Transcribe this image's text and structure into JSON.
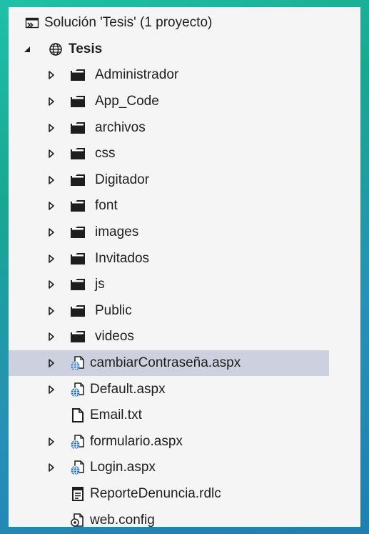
{
  "solution": {
    "label": "Solución 'Tesis'  (1 proyecto)",
    "icon": "solution-icon"
  },
  "project": {
    "label": "Tesis",
    "icon": "globe-web-project-icon",
    "expanded": true
  },
  "items": [
    {
      "label": "Administrador",
      "type": "folder",
      "expander": true
    },
    {
      "label": "App_Code",
      "type": "folder",
      "expander": true
    },
    {
      "label": "archivos",
      "type": "folder",
      "expander": true
    },
    {
      "label": "css",
      "type": "folder",
      "expander": true
    },
    {
      "label": "Digitador",
      "type": "folder",
      "expander": true
    },
    {
      "label": "font",
      "type": "folder",
      "expander": true
    },
    {
      "label": "images",
      "type": "folder",
      "expander": true
    },
    {
      "label": "Invitados",
      "type": "folder",
      "expander": true
    },
    {
      "label": "js",
      "type": "folder",
      "expander": true
    },
    {
      "label": "Public",
      "type": "folder",
      "expander": true
    },
    {
      "label": "videos",
      "type": "folder",
      "expander": true
    },
    {
      "label": "cambiarContraseña.aspx",
      "type": "aspx",
      "expander": true,
      "selected": true
    },
    {
      "label": "Default.aspx",
      "type": "aspx",
      "expander": true
    },
    {
      "label": "Email.txt",
      "type": "txt",
      "expander": false
    },
    {
      "label": "formulario.aspx",
      "type": "aspx",
      "expander": true
    },
    {
      "label": "Login.aspx",
      "type": "aspx",
      "expander": true
    },
    {
      "label": "ReporteDenuncia.rdlc",
      "type": "rdlc",
      "expander": false
    },
    {
      "label": "web.config",
      "type": "config",
      "expander": false
    }
  ],
  "colors": {
    "selection": "#cdd1df",
    "panel": "#f5f5f5",
    "text": "#1e1e1e",
    "globe_blue": "#1f6fbf"
  }
}
